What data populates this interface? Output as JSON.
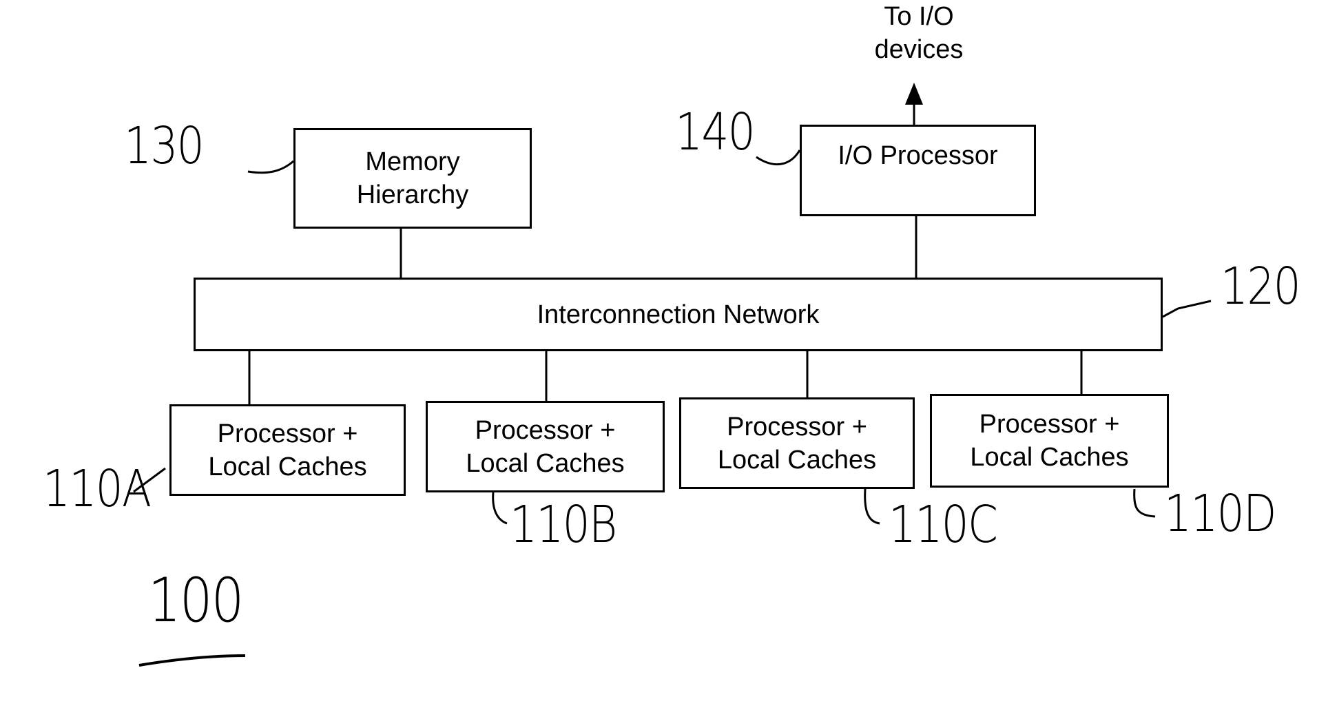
{
  "diagram": {
    "figure_ref": "100",
    "io_output_label": [
      "To I/O",
      "devices"
    ],
    "memory": {
      "ref": "130",
      "lines": [
        "Memory",
        "Hierarchy"
      ]
    },
    "io_processor": {
      "ref": "140",
      "lines": [
        "I/O Processor"
      ]
    },
    "interconnect": {
      "ref": "120",
      "label": "Interconnection Network"
    },
    "processors": [
      {
        "ref": "110A",
        "lines": [
          "Processor +",
          "Local Caches"
        ]
      },
      {
        "ref": "110B",
        "lines": [
          "Processor +",
          "Local Caches"
        ]
      },
      {
        "ref": "110C",
        "lines": [
          "Processor +",
          "Local Caches"
        ]
      },
      {
        "ref": "110D",
        "lines": [
          "Processor +",
          "Local Caches"
        ]
      }
    ]
  }
}
